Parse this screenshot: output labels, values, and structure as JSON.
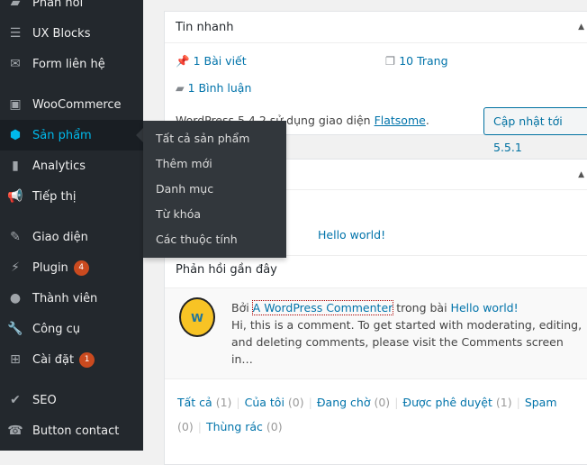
{
  "sidebar": {
    "items": [
      {
        "label": "Phản hồi",
        "icon": "comment-icon"
      },
      {
        "label": "UX Blocks",
        "icon": "blocks-icon"
      },
      {
        "label": "Form liên hệ",
        "icon": "mail-icon"
      },
      {
        "label": "WooCommerce",
        "icon": "woo-icon"
      },
      {
        "label": "Sản phẩm",
        "icon": "box-icon",
        "active": true
      },
      {
        "label": "Analytics",
        "icon": "chart-icon"
      },
      {
        "label": "Tiếp thị",
        "icon": "megaphone-icon"
      },
      {
        "label": "Giao diện",
        "icon": "brush-icon"
      },
      {
        "label": "Plugin",
        "icon": "plugin-icon",
        "badge": "4"
      },
      {
        "label": "Thành viên",
        "icon": "user-icon"
      },
      {
        "label": "Công cụ",
        "icon": "wrench-icon"
      },
      {
        "label": "Cài đặt",
        "icon": "settings-icon",
        "badge": "1"
      },
      {
        "label": "SEO",
        "icon": "seo-icon"
      },
      {
        "label": "Button contact",
        "icon": "phone-icon"
      }
    ],
    "flyout": [
      "Tất cả sản phẩm",
      "Thêm mới",
      "Danh mục",
      "Từ khóa",
      "Các thuộc tính"
    ]
  },
  "glance": {
    "title": "Tin nhanh",
    "posts": "1 Bài viết",
    "pages": "10 Trang",
    "comments": "1 Bình luận",
    "theme_text": "WordPress 5.4.2 sử dụng giao diện ",
    "theme_link": "Flatsome",
    "theme_end": ".",
    "update_button": "Cập nhật tới 5.5.1"
  },
  "activity": {
    "post_link": "Hello world!",
    "recent_title": "Phản hồi gần đây",
    "comment": {
      "by": "Bởi ",
      "author": "A WordPress Commenter",
      "in": " trong bài ",
      "post": "Hello world!",
      "text": "Hi, this is a comment. To get started with moderating, editing, and deleting comments, please visit the Comments screen in…"
    },
    "filters": [
      {
        "label": "Tất cả",
        "count": "(1)"
      },
      {
        "label": "Của tôi",
        "count": "(0)"
      },
      {
        "label": "Đang chờ",
        "count": "(0)"
      },
      {
        "label": "Được phê duyệt",
        "count": "(1)"
      },
      {
        "label": "Spam",
        "count": "(0)"
      },
      {
        "label": "Thùng rác",
        "count": "(0)"
      }
    ]
  },
  "colors": {
    "sidebar": "#23282d",
    "accent": "#00b9eb",
    "link": "#0073aa",
    "badge": "#ca4a1f"
  }
}
